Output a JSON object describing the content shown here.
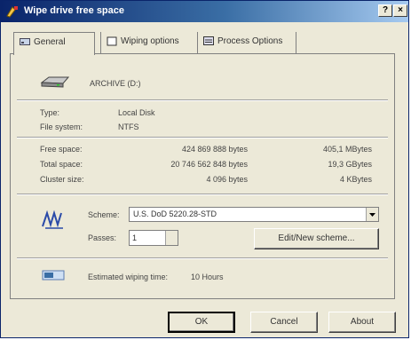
{
  "window": {
    "title": "Wipe drive free space",
    "help_glyph": "?",
    "close_glyph": "×"
  },
  "tabs": [
    {
      "label": "General",
      "icon": "disk-icon"
    },
    {
      "label": "Wiping options",
      "icon": "options-icon"
    },
    {
      "label": "Process Options",
      "icon": "process-icon"
    }
  ],
  "drive": {
    "label": "ARCHIVE (D:)",
    "icon": "drive-icon"
  },
  "info": {
    "type_label": "Type:",
    "type_value": "Local Disk",
    "fs_label": "File system:",
    "fs_value": "NTFS"
  },
  "space": {
    "free_label": "Free space:",
    "free_bytes": "424 869 888 bytes",
    "free_human": "405,1 MBytes",
    "total_label": "Total space:",
    "total_bytes": "20 746 562 848 bytes",
    "total_human": "19,3 GBytes",
    "cluster_label": "Cluster size:",
    "cluster_bytes": "4 096 bytes",
    "cluster_human": "4 KBytes"
  },
  "scheme": {
    "label": "Scheme:",
    "value": "U.S. DoD 5220.28-STD",
    "passes_label": "Passes:",
    "passes_value": "1",
    "edit_button": "Edit/New scheme..."
  },
  "estimate": {
    "label": "Estimated wiping time:",
    "value": "10 Hours"
  },
  "buttons": {
    "ok": "OK",
    "cancel": "Cancel",
    "about": "About"
  }
}
